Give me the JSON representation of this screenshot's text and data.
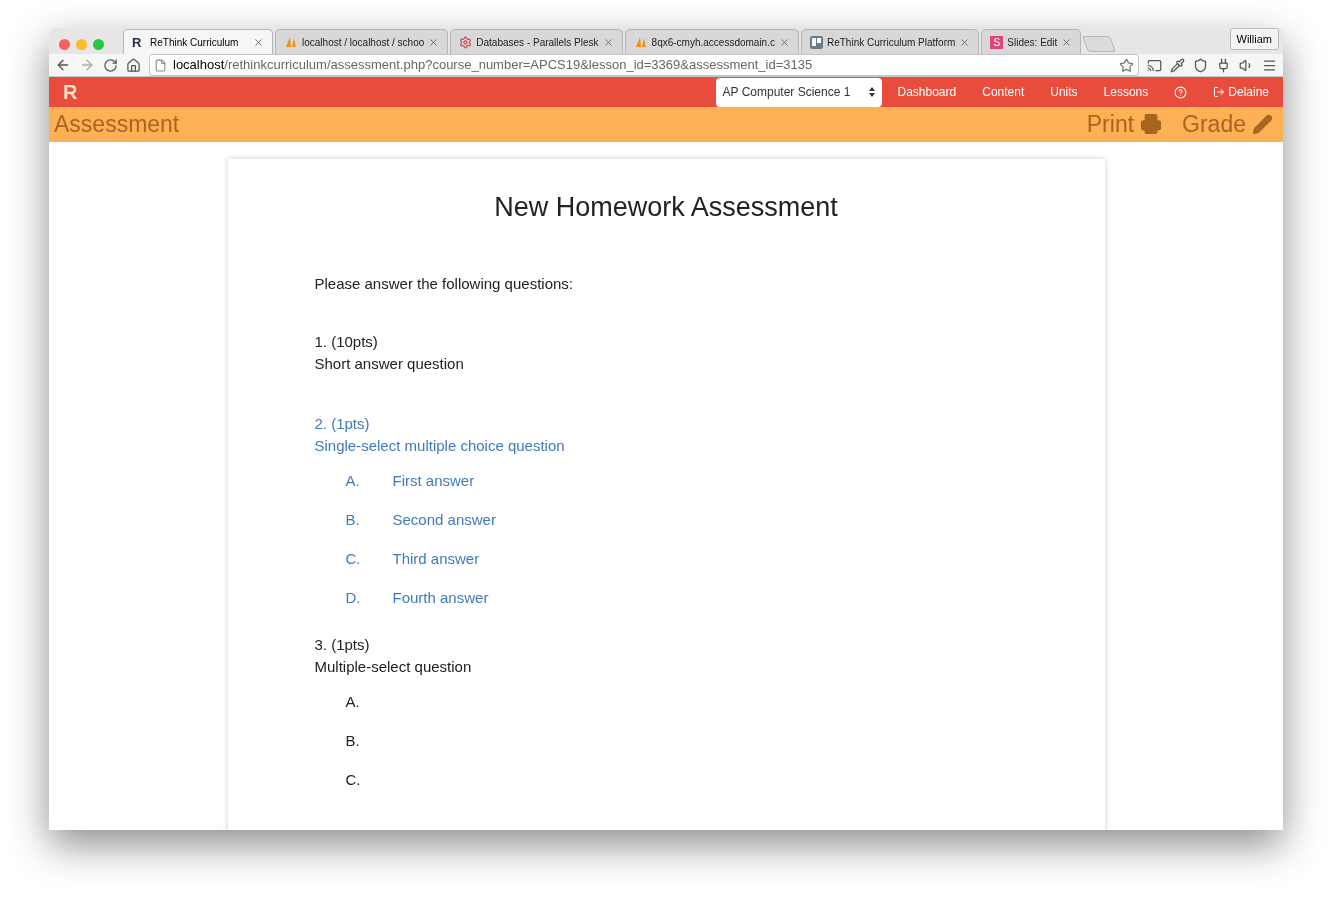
{
  "browser": {
    "tabs": [
      {
        "title": "ReThink Curriculum",
        "kind": "letter",
        "icon_text": "R",
        "selected": true
      },
      {
        "title": "localhost / localhost / schoo",
        "kind": "pma",
        "selected": false
      },
      {
        "title": "Databases - Parallels Plesk",
        "kind": "gear",
        "selected": false
      },
      {
        "title": "8qx6-cmyh.accessdomain.c",
        "kind": "pma",
        "selected": false
      },
      {
        "title": "ReThink Curriculum Platform",
        "kind": "board",
        "selected": false
      },
      {
        "title": "Slides: Edit",
        "kind": "square",
        "icon_text": "S",
        "selected": false
      }
    ],
    "profile": "William",
    "url": {
      "host": "localhost",
      "path": "/rethinkcurriculum/assessment.php?course_number=APCS19&lesson_id=3369&assessment_id=3135"
    }
  },
  "navbar": {
    "brand": "R",
    "course_select": "AP Computer Science 1",
    "links": [
      "Dashboard",
      "Content",
      "Units",
      "Lessons"
    ],
    "user": "Delaine"
  },
  "subheader": {
    "title": "Assessment",
    "actions": [
      {
        "label": "Print",
        "kind": "print"
      },
      {
        "label": "Grade",
        "kind": "grade"
      }
    ]
  },
  "assessment": {
    "title": "New Homework Assessment",
    "instructions": "Please answer the following questions:",
    "questions": [
      {
        "number": "1. (10pts)",
        "text": "Short answer question",
        "selected": false
      },
      {
        "number": "2. (1pts)",
        "text": "Single-select multiple choice question",
        "selected": true,
        "options": [
          {
            "letter": "A.",
            "text": "First answer"
          },
          {
            "letter": "B.",
            "text": "Second answer"
          },
          {
            "letter": "C.",
            "text": "Third answer"
          },
          {
            "letter": "D.",
            "text": "Fourth answer"
          }
        ]
      },
      {
        "number": "3. (1pts)",
        "text": "Multiple-select question",
        "selected": false,
        "options": [
          {
            "letter": "A."
          },
          {
            "letter": "B."
          },
          {
            "letter": "C."
          }
        ]
      }
    ]
  }
}
